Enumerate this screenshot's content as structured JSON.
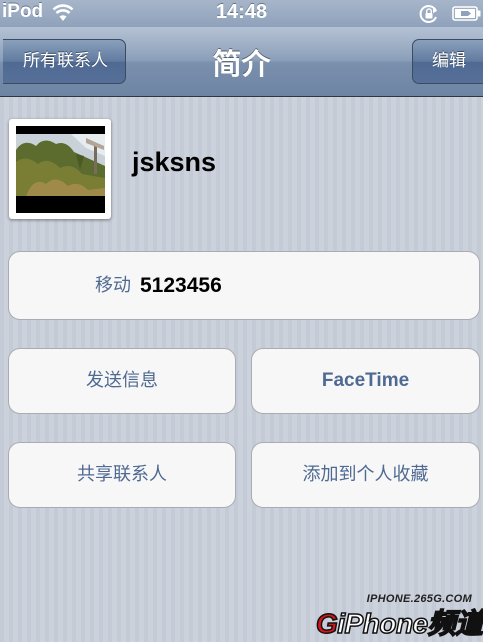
{
  "status_bar": {
    "carrier": "iPod",
    "time": "14:48",
    "icons": [
      "wifi-icon",
      "rotation-lock-icon",
      "battery-charging-icon"
    ]
  },
  "nav_bar": {
    "back_label": "所有联系人",
    "title": "简介",
    "edit_label": "编辑"
  },
  "contact": {
    "name": "jsksns",
    "photo_icon": "contact-photo"
  },
  "phone": {
    "label": "移动",
    "number": "5123456"
  },
  "actions": {
    "send_message": "发送信息",
    "facetime": "FaceTime",
    "share_contact": "共享联系人",
    "add_to_favorites": "添加到个人收藏"
  },
  "watermark": {
    "url": "IPHONE.265G.COM",
    "logo": "GiPhone频道"
  },
  "colors": {
    "nav_bar": "#7a90ad",
    "action_text": "#4f6a92",
    "background": "#c7cdd8",
    "cell_background": "#f7f7f7"
  }
}
